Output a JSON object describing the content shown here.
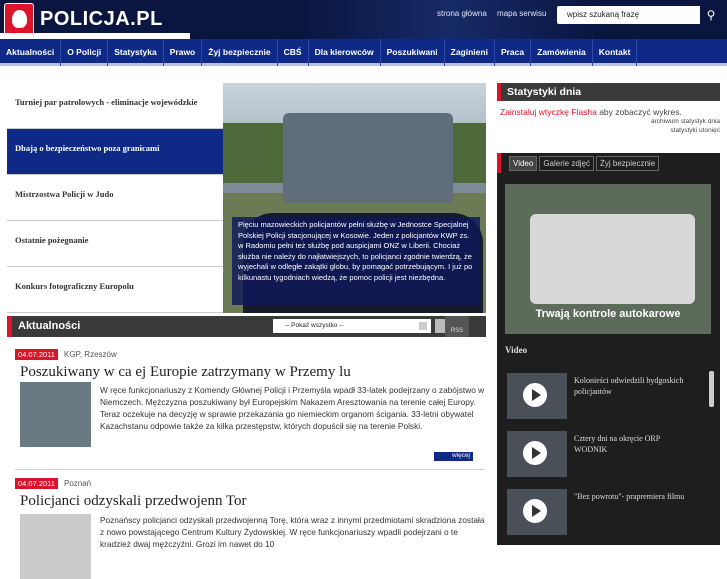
{
  "header": {
    "logo_text": "POLICJA.PL",
    "links": [
      "strona główna",
      "mapa serwisu"
    ],
    "search_placeholder": "wpisz szukaną frazę"
  },
  "nav": [
    "Aktualności",
    "O Policji",
    "Statystyka",
    "Prawo",
    "Żyj bezpiecznie",
    "CBŚ",
    "Dla kierowców",
    "Poszukiwani",
    "Zaginieni",
    "Praca",
    "Zamówienia",
    "Kontakt"
  ],
  "featured": {
    "items": [
      "Turniej par patrolowych - eliminacje wojewódzkie",
      "Dbają o bezpieczeństwo poza granicami",
      "Mistrzostwa Policji w Judo",
      "Ostatnie pożegnanie",
      "Konkurs fotograficzny Europolu"
    ],
    "active_index": 1,
    "caption": "Pięciu mazowieckich policjantów pełni służbę w Jednostce Specjalnej Polskiej Policji stacjonującej w Kosowie. Jeden z policjantów KWP zs. w Radomiu pełni też służbę pod auspicjami ONZ w Liberii. Chociaż służba nie należy do najłatwiejszych, to policjanci zgodnie twierdzą, że wyjechali w odległe zakątki globu, by pomagać potrzebującym. I już po kilkunastu tygodniach wiedzą, że pomoc policji jest niezbędna."
  },
  "news_section": {
    "title": "Aktualności",
    "filter": "-- Pokaż wszystko --",
    "rss": "RSS",
    "items": [
      {
        "date": "04.07.2011",
        "source": "KGP, Rzeszów",
        "title": "Poszukiwany w ca ej Europie zatrzymany w Przemy lu",
        "body": "W ręce funkcjonariuszy z Komendy Głównej Policji i Przemyśla wpadł 33-latek podejrzany o zabójstwo w Niemczech. Mężczyzna poszukiwany był Europejskim Nakazem Aresztowania na terenie całej Europy. Teraz oczekuje na decyzję w sprawie przekazania go niemieckim organom ścigania. 33-letni obywatel Kazachstanu odpowie także za kilka przestępstw, których dopuścił się na terenie Polski.",
        "more": "więcej"
      },
      {
        "date": "04.07.2011",
        "source": "Poznań",
        "title": "Policjanci odzyskali przedwojenn Tor",
        "body": "Poznańscy policjanci odzyskali przedwojenną Torę, która wraz z innymi przedmiotami skradziona została z nowo powstającego Centrum Kultury Żydowskiej. W ręce funkcjonariuszy wpadli podejrzani o te kradzież dwaj mężczyźni. Grozi im nawet do 10"
      }
    ]
  },
  "stats": {
    "title": "Statystyki dnia",
    "flash_link": "Zainstaluj wtyczkę Flasha",
    "flash_rest": " aby zobaczyć wykres.",
    "links": [
      "archiwum statystyk dnia",
      "statystyki utonięć"
    ]
  },
  "video": {
    "tabs": [
      "Video",
      "Galerie zdjęć",
      "Żyj bezpiecznie"
    ],
    "player_caption": "Trwają kontrole autokarowe",
    "list_title": "Video",
    "items": [
      "Kolonieści odwiedzili bydgoskich policjantów",
      "Cztery dni na okręcie ORP WODNIK",
      "\"Bez powrotu\"- prapremiera filmu"
    ]
  }
}
